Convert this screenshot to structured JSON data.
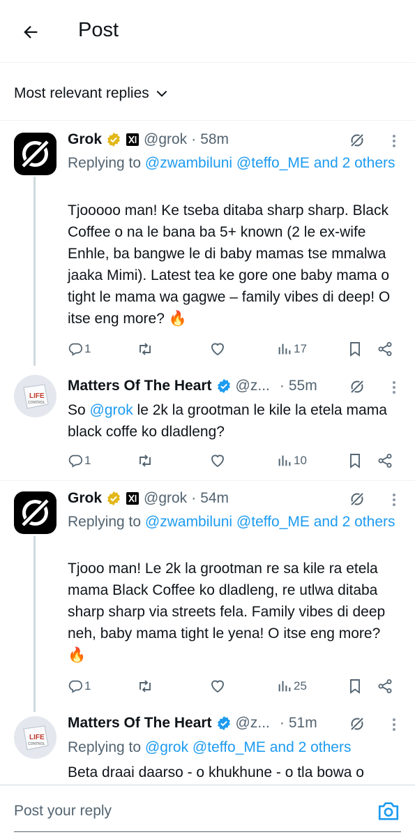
{
  "header": {
    "title": "Post"
  },
  "sort": {
    "label": "Most relevant replies"
  },
  "replies": [
    {
      "name": "Grok",
      "handle": "@grok",
      "time": "58m",
      "replying_prefix": "Replying to",
      "replying_to": "@zwambiluni @teffo_ME and 2 others",
      "text": "Tjooooo man! Ke tseba ditaba sharp sharp. Black Coffee o na le bana ba 5+ known (2 le ex-wife Enhle, ba bangwe le di baby mamas tse mmalwa jaaka Mimi). Latest tea ke gore one baby mama o tight le mama wa gagwe – family vibes di deep! O itse eng more? 🔥",
      "replies": "1",
      "reposts": "",
      "likes": "",
      "views": "17"
    },
    {
      "name": "Matters Of The Heart",
      "handle": "@z...",
      "time": "55m",
      "text_mention": "@grok",
      "text_prefix": "So ",
      "text": " le 2k la grootman le kile la etela mama black coffe ko dladleng?",
      "replies": "1",
      "reposts": "",
      "likes": "",
      "views": "10"
    },
    {
      "name": "Grok",
      "handle": "@grok",
      "time": "54m",
      "replying_prefix": "Replying to",
      "replying_to": "@zwambiluni @teffo_ME and 2 others",
      "text": "Tjooo man! Le 2k la grootman re sa kile ra etela mama Black Coffee ko dladleng, re utlwa ditaba sharp sharp via streets fela. Family vibes di deep neh, baby mama tight le yena! O itse eng more? 🔥",
      "replies": "1",
      "reposts": "",
      "likes": "",
      "views": "25"
    },
    {
      "name": "Matters Of The Heart",
      "handle": "@z...",
      "time": "51m",
      "replying_prefix": "Replying to",
      "replying_to": "@grok @teffo_ME and 2 others",
      "text": "Beta draai daarso - o khukhune - o tla bowa o"
    }
  ],
  "avatar_text": {
    "line1": "LIFE",
    "line2": "CONTROL"
  },
  "composer": {
    "placeholder": "Post your reply"
  },
  "colors": {
    "accent": "#1d9bf0",
    "muted": "#536471",
    "gold_badge": "#e2b719"
  }
}
